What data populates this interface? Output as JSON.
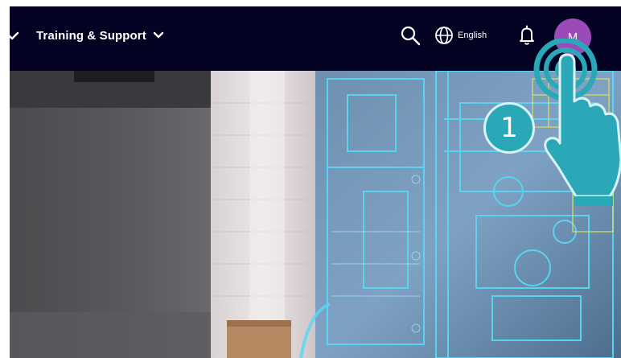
{
  "nav": {
    "training_label": "Training & Support",
    "language_label": "English",
    "avatar_initial": "M"
  },
  "annotation": {
    "step_number": "1"
  },
  "colors": {
    "topbar": "#050324",
    "avatar": "#9b4bb8",
    "annotation": "#2aa8b8"
  },
  "icons": [
    "chevron-down-icon",
    "search-icon",
    "globe-icon",
    "bell-icon",
    "tap-hand-icon"
  ]
}
